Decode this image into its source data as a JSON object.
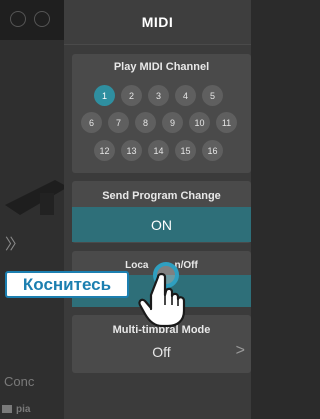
{
  "panel": {
    "title": "MIDI"
  },
  "play_midi_channel": {
    "label": "Play MIDI Channel",
    "selected": "1",
    "rows": [
      [
        "1",
        "2",
        "3",
        "4",
        "5"
      ],
      [
        "6",
        "7",
        "8",
        "9",
        "10",
        "11"
      ],
      [
        "12",
        "13",
        "14",
        "15",
        "16"
      ]
    ]
  },
  "send_program_change": {
    "label": "Send Program Change",
    "value": "ON"
  },
  "local_control": {
    "label_visible_part1": "Loca",
    "label_visible_part2": "n/Off"
  },
  "multi_timbral": {
    "label": "Multi-timbral Mode",
    "value": "Off",
    "arrow": ">"
  },
  "tutorial": {
    "touch_label": "Коснитесь"
  },
  "background": {
    "chevron": "〉〉",
    "label": "Conc",
    "bottom_text": "pia"
  },
  "colors": {
    "accent": "#2f8fa0",
    "selected_bar": "#2e6f79",
    "panel": "#3b3b3b",
    "card": "#4a4a4a",
    "tutorial_blue": "#1c7fb0"
  }
}
